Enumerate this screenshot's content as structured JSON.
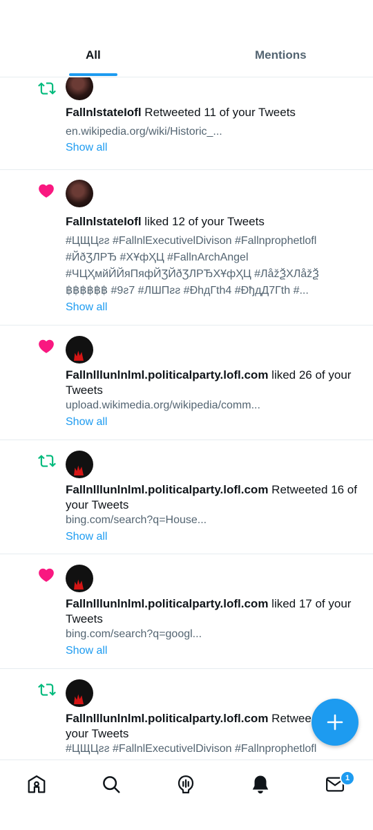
{
  "tabs": {
    "all": "All",
    "mentions": "Mentions"
  },
  "notifications": [
    {
      "type": "retweet",
      "user": "FallnlstateIofl",
      "action": " Retweeted 11 of your Tweets",
      "link": "en.wikipedia.org/wiki/Historic_...",
      "show_all": "Show all"
    },
    {
      "type": "like",
      "user": "FallnlstateIofl",
      "action": " liked 12 of your Tweets",
      "hashtags": [
        "#ЦЩЦƨƨ #FallnlExecutivelDivison #Fallnprophetlofl",
        "#ЙðƷЛРЂ #ХҰфҲЦ #FallnArchAngel",
        "#ЧЦҲмйЙЙяПяфЙƷЙðƷЛРЂХҰфҲЦ #ЛåžѮХЛåžѮ",
        "฿฿฿฿฿฿ #9ƨ7 #ЛШПƨƨ #ÐhдГth4 #ÐђдД7Гth #..."
      ],
      "show_all": "Show all"
    },
    {
      "type": "like",
      "user": "Fallnlllunlnlml.politicalparty.lofl.com",
      "action": " liked 26 of your Tweets",
      "link": "upload.wikimedia.org/wikipedia/comm...",
      "show_all": "Show all"
    },
    {
      "type": "retweet",
      "user": "Fallnlllunlnlml.politicalparty.lofl.com",
      "action": " Retweeted 16 of your Tweets",
      "link": "bing.com/search?q=House...",
      "show_all": "Show all"
    },
    {
      "type": "like",
      "user": "Fallnlllunlnlml.politicalparty.lofl.com",
      "action": " liked 17 of your Tweets",
      "link": "bing.com/search?q=googl...",
      "show_all": "Show all"
    },
    {
      "type": "retweet",
      "user": "Fallnlllunlnlml.politicalparty.lofl.com",
      "action": " Retweeted",
      "action2": "your Tweets",
      "hashtag_line": "#ЦЩЦƨƨ #FallnlExecutivelDivison #Fallnprophetlofl"
    }
  ],
  "nav": {
    "messages_badge": "1"
  },
  "colors": {
    "accent": "#1d9bf0",
    "retweet": "#00ba7c",
    "like": "#f91880",
    "text": "#0f1419",
    "muted": "#536471"
  },
  "icons": [
    "retweet-icon",
    "heart-icon",
    "home-icon",
    "search-icon",
    "spaces-icon",
    "bell-icon",
    "mail-icon",
    "plus-icon"
  ]
}
